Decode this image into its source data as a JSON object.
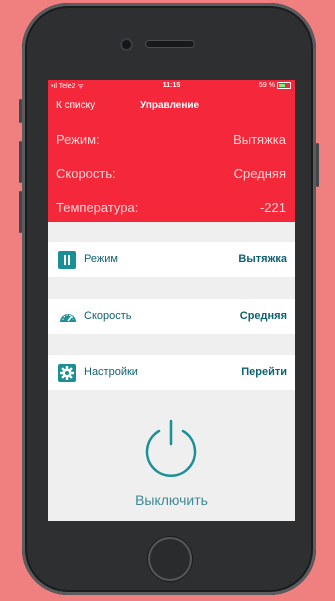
{
  "status_bar": {
    "carrier": "Tele2",
    "time": "11:15",
    "battery": "59 %",
    "battery_level": 0.59
  },
  "nav": {
    "back_label": "К списку",
    "title": "Управление"
  },
  "summary": [
    {
      "label": "Режим:",
      "value": "Вытяжка"
    },
    {
      "label": "Скорость:",
      "value": "Средняя"
    },
    {
      "label": "Температура:",
      "value": "-221"
    }
  ],
  "controls": [
    {
      "label": "Режим",
      "value": "Вытяжка",
      "icon": "pause-icon"
    },
    {
      "label": "Скорость",
      "value": "Средняя",
      "icon": "speedometer-icon"
    },
    {
      "label": "Настройки",
      "value": "Перейти",
      "icon": "gear-icon"
    }
  ],
  "power_button": {
    "label": "Выключить",
    "icon": "power-icon"
  },
  "colors": {
    "header": "#f4283a",
    "accent": "#1b8f96",
    "text_dark": "#0f6270"
  }
}
